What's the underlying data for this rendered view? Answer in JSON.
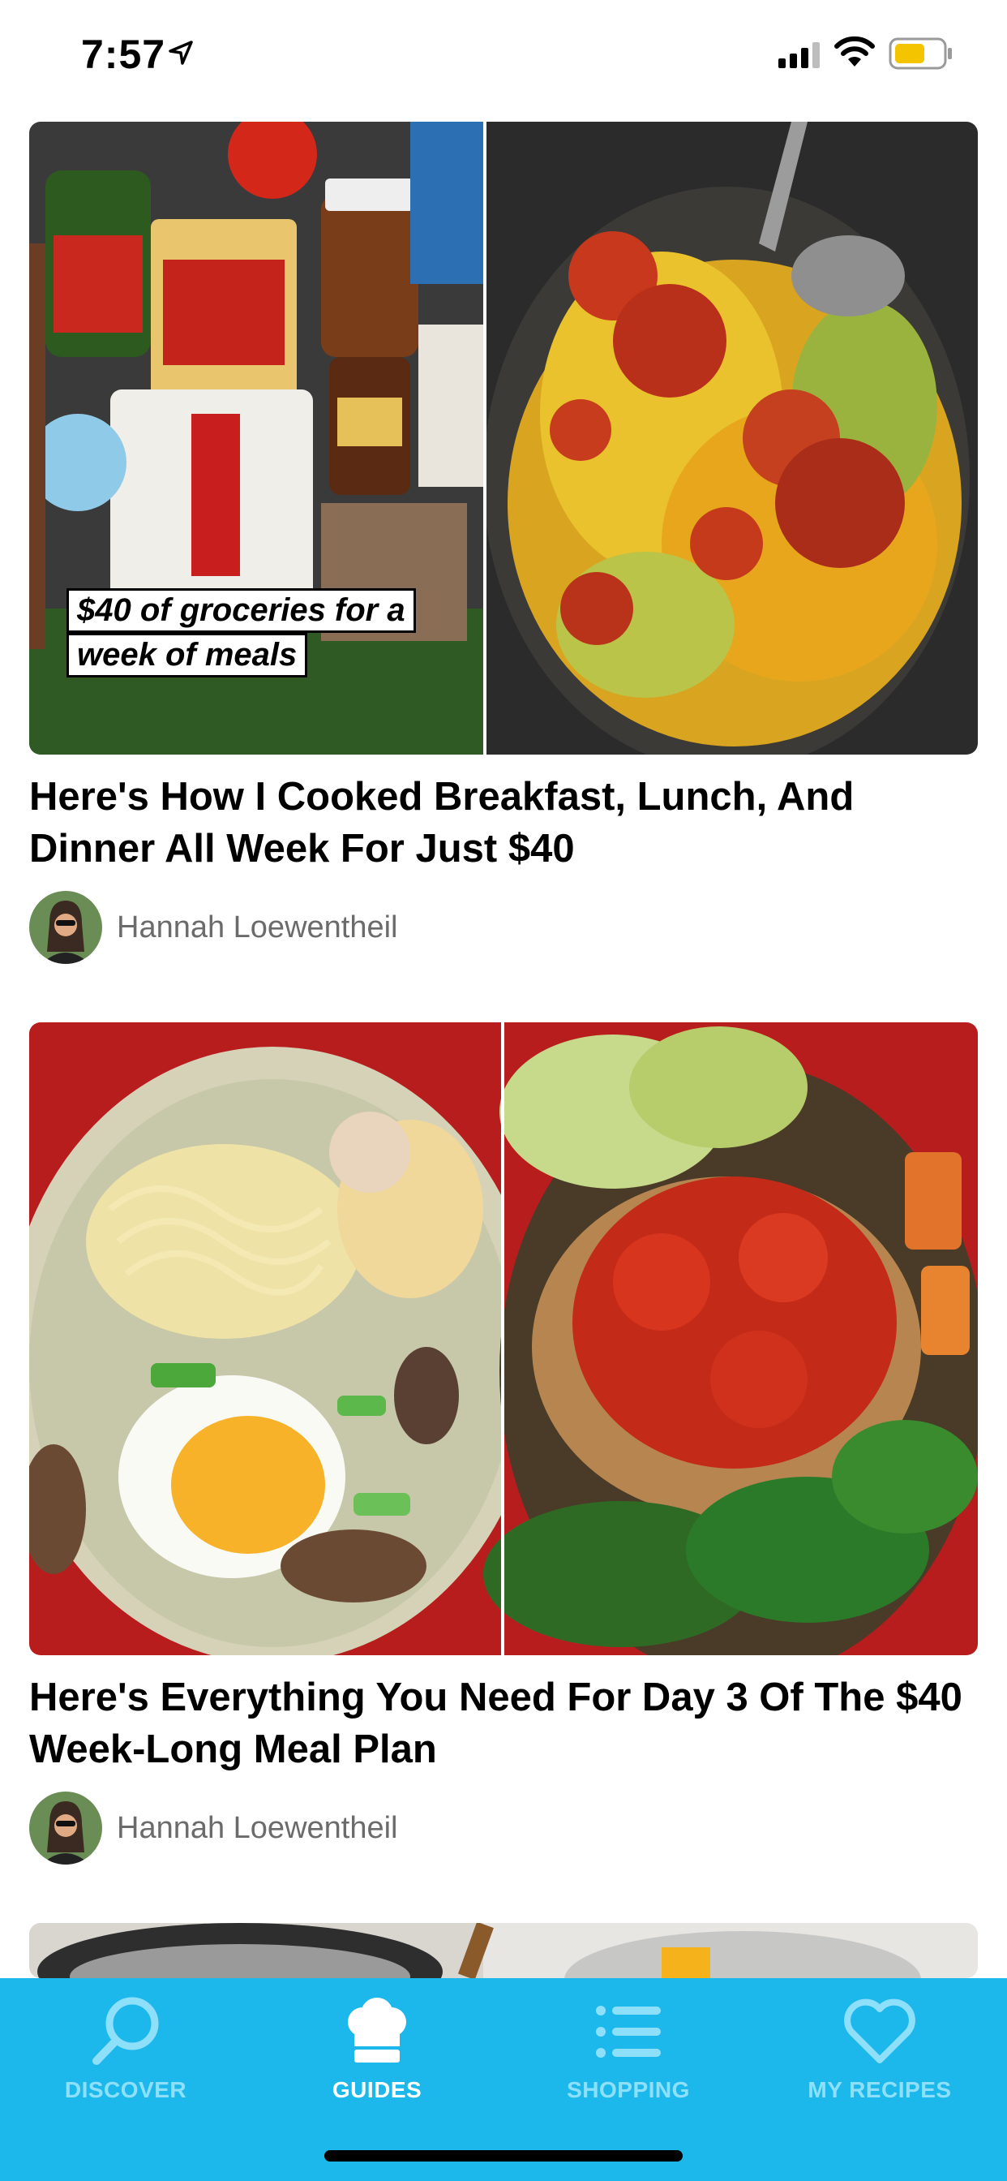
{
  "status": {
    "time": "7:57"
  },
  "cards": [
    {
      "overlay_line1": "$40 of groceries for a",
      "overlay_line2": "week of meals",
      "title": "Here's How I Cooked Breakfast, Lunch, And Dinner All Week For Just $40",
      "author": "Hannah Loewentheil"
    },
    {
      "title": "Here's Everything You Need For Day 3 Of The $40 Week-Long Meal Plan",
      "author": "Hannah Loewentheil"
    }
  ],
  "tabs": [
    {
      "label": "DISCOVER",
      "icon": "search-icon",
      "active": false
    },
    {
      "label": "GUIDES",
      "icon": "chef-hat-icon",
      "active": true
    },
    {
      "label": "SHOPPING",
      "icon": "list-icon",
      "active": false
    },
    {
      "label": "MY RECIPES",
      "icon": "heart-icon",
      "active": false
    }
  ],
  "colors": {
    "tab_bar": "#1cb8ec",
    "tab_active": "#ffffff",
    "tab_inactive": "#8ee0fa"
  }
}
